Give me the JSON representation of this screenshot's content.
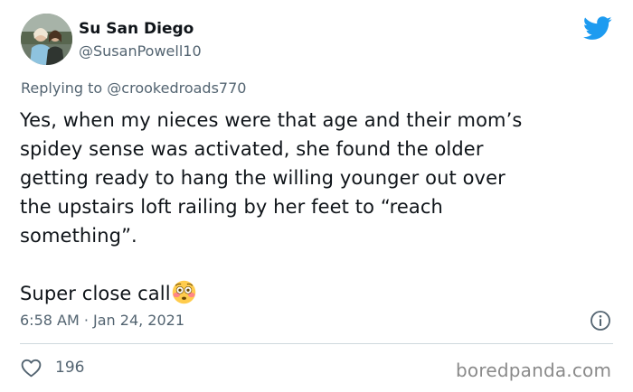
{
  "author": {
    "display_name": "Su San Diego",
    "handle": "@SusanPowell10"
  },
  "reply": {
    "prefix": "Replying to",
    "mention": "@crookedroads770"
  },
  "tweet": {
    "lines": [
      "Yes, when my nieces were that age and their mom’s",
      "spidey sense was activated, she found the older",
      "getting ready to hang the willing younger out over",
      "the upstairs loft railing by her feet to “reach",
      "something”."
    ],
    "closing": "Super close call",
    "emoji": "flushed-face"
  },
  "meta": {
    "timestamp": "6:58 AM · Jan 24, 2021"
  },
  "actions": {
    "like_count": "196"
  },
  "watermark": "boredpanda.com",
  "colors": {
    "twitter_blue": "#1d9bf0",
    "text_primary": "#0f1419",
    "text_secondary": "#536471",
    "divider": "#cfd9de"
  }
}
